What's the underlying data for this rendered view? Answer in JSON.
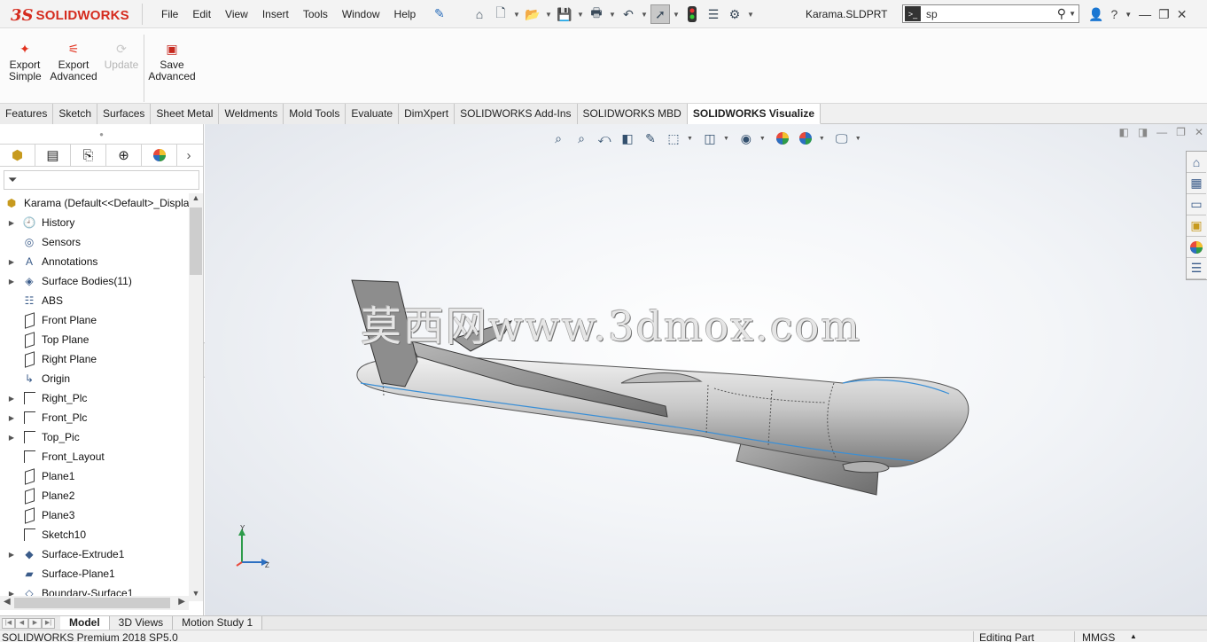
{
  "app": {
    "logo_prefix": "3S",
    "logo_text": "SOLIDWORKS",
    "document_title": "Karama.SLDPRT"
  },
  "menu": [
    "File",
    "Edit",
    "View",
    "Insert",
    "Tools",
    "Window",
    "Help"
  ],
  "quick_access": [
    "home-icon",
    "new-document-icon",
    "open-icon",
    "save-icon",
    "print-icon",
    "undo-icon",
    "select-arrow-icon",
    "rebuild-traffic-light-icon",
    "file-properties-icon",
    "options-gear-icon"
  ],
  "search": {
    "value": "sp",
    "prompt_glyph": ">_"
  },
  "ribbon": {
    "buttons": [
      {
        "label_line1": "Export",
        "label_line2": "Simple",
        "enabled": true
      },
      {
        "label_line1": "Export",
        "label_line2": "Advanced",
        "enabled": true
      },
      {
        "label_line1": "Update",
        "label_line2": "",
        "enabled": false
      },
      {
        "label_line1": "Save",
        "label_line2": "Advanced",
        "enabled": true
      }
    ]
  },
  "tabs": [
    "Features",
    "Sketch",
    "Surfaces",
    "Sheet Metal",
    "Weldments",
    "Mold Tools",
    "Evaluate",
    "DimXpert",
    "SOLIDWORKS Add-Ins",
    "SOLIDWORKS MBD",
    "SOLIDWORKS Visualize"
  ],
  "active_tab": "SOLIDWORKS Visualize",
  "feature_manager": {
    "root_label": "Karama  (Default<<Default>_Displa",
    "items": [
      {
        "label": "History",
        "expandable": true,
        "icon": "history-icon"
      },
      {
        "label": "Sensors",
        "expandable": false,
        "icon": "sensors-icon"
      },
      {
        "label": "Annotations",
        "expandable": true,
        "icon": "annotations-icon"
      },
      {
        "label": "Surface Bodies(11)",
        "expandable": true,
        "icon": "surface-bodies-icon"
      },
      {
        "label": "ABS",
        "expandable": false,
        "icon": "material-icon"
      },
      {
        "label": "Front Plane",
        "expandable": false,
        "icon": "plane-icon"
      },
      {
        "label": "Top Plane",
        "expandable": false,
        "icon": "plane-icon"
      },
      {
        "label": "Right Plane",
        "expandable": false,
        "icon": "plane-icon"
      },
      {
        "label": "Origin",
        "expandable": false,
        "icon": "origin-icon"
      },
      {
        "label": "Right_Plc",
        "expandable": true,
        "icon": "sketch-icon"
      },
      {
        "label": "Front_Plc",
        "expandable": true,
        "icon": "sketch-icon"
      },
      {
        "label": "Top_Pic",
        "expandable": true,
        "icon": "sketch-icon"
      },
      {
        "label": "Front_Layout",
        "expandable": false,
        "icon": "sketch-icon"
      },
      {
        "label": "Plane1",
        "expandable": false,
        "icon": "plane-icon"
      },
      {
        "label": "Plane2",
        "expandable": false,
        "icon": "plane-icon"
      },
      {
        "label": "Plane3",
        "expandable": false,
        "icon": "plane-icon"
      },
      {
        "label": "Sketch10",
        "expandable": false,
        "icon": "sketch-icon"
      },
      {
        "label": "Surface-Extrude1",
        "expandable": true,
        "icon": "surface-extrude-icon"
      },
      {
        "label": "Surface-Plane1",
        "expandable": false,
        "icon": "surface-plane-icon"
      },
      {
        "label": "Boundary-Surface1",
        "expandable": true,
        "icon": "boundary-surface-icon"
      }
    ]
  },
  "watermark": "莫西网www.3dmox.com",
  "triad": {
    "y": "Y",
    "z": "Z"
  },
  "bottom_tabs": [
    "Model",
    "3D Views",
    "Motion Study 1"
  ],
  "active_bottom_tab": "Model",
  "status": {
    "product": "SOLIDWORKS Premium 2018 SP5.0",
    "mode": "Editing Part",
    "units": "MMGS"
  }
}
